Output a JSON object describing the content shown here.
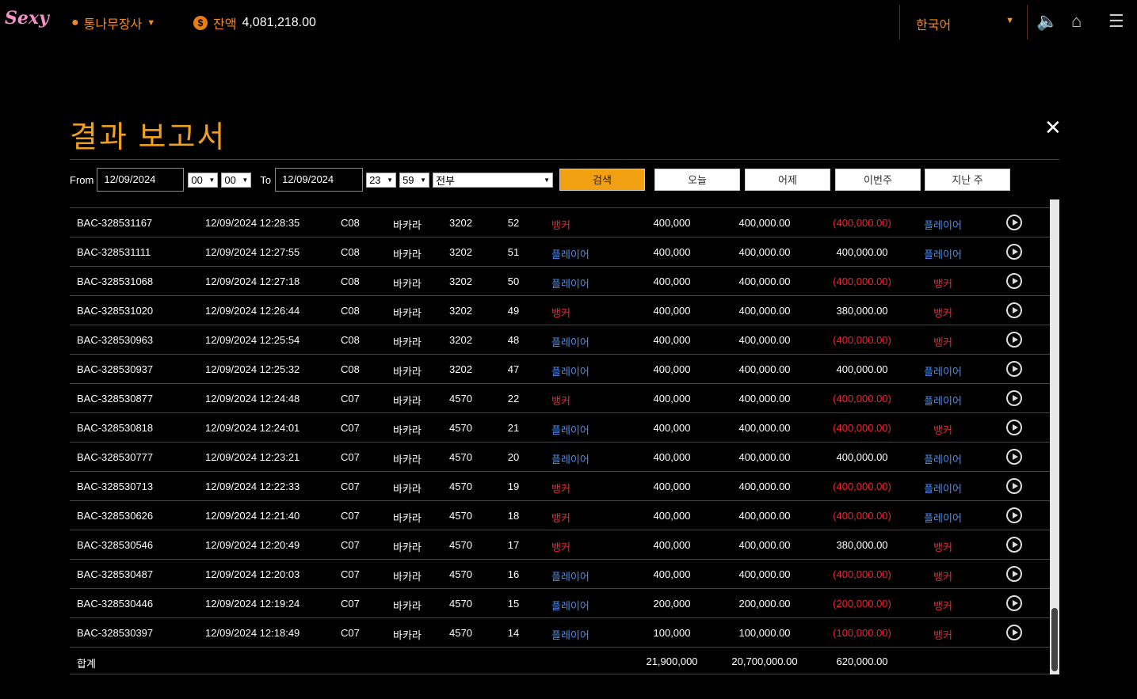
{
  "header": {
    "logo": "Sexy",
    "username": "통나무장사",
    "balance_label": "잔액",
    "balance": "4,081,218.00",
    "language": "한국어"
  },
  "title": "결과 보고서",
  "filters": {
    "from_label": "From",
    "from_date": "12/09/2024",
    "from_hour": "00",
    "from_min": "00",
    "to_label": "To",
    "to_date": "12/09/2024",
    "to_hour": "23",
    "to_min": "59",
    "game_type": "전부"
  },
  "buttons": {
    "search": "검색",
    "today": "오늘",
    "yesterday": "어제",
    "this_week": "이번주",
    "last_week": "지난 주"
  },
  "rows": [
    [
      "BAC-328531167",
      "12/09/2024 12:28:35",
      "C08",
      "바카라",
      "3202",
      "52",
      "뱅커",
      "400,000",
      "400,000.00",
      "(400,000.00)",
      "플레이어"
    ],
    [
      "BAC-328531111",
      "12/09/2024 12:27:55",
      "C08",
      "바카라",
      "3202",
      "51",
      "플레이어",
      "400,000",
      "400,000.00",
      "400,000.00",
      "플레이어"
    ],
    [
      "BAC-328531068",
      "12/09/2024 12:27:18",
      "C08",
      "바카라",
      "3202",
      "50",
      "플레이어",
      "400,000",
      "400,000.00",
      "(400,000.00)",
      "뱅커"
    ],
    [
      "BAC-328531020",
      "12/09/2024 12:26:44",
      "C08",
      "바카라",
      "3202",
      "49",
      "뱅커",
      "400,000",
      "400,000.00",
      "380,000.00",
      "뱅커"
    ],
    [
      "BAC-328530963",
      "12/09/2024 12:25:54",
      "C08",
      "바카라",
      "3202",
      "48",
      "플레이어",
      "400,000",
      "400,000.00",
      "(400,000.00)",
      "뱅커"
    ],
    [
      "BAC-328530937",
      "12/09/2024 12:25:32",
      "C08",
      "바카라",
      "3202",
      "47",
      "플레이어",
      "400,000",
      "400,000.00",
      "400,000.00",
      "플레이어"
    ],
    [
      "BAC-328530877",
      "12/09/2024 12:24:48",
      "C07",
      "바카라",
      "4570",
      "22",
      "뱅커",
      "400,000",
      "400,000.00",
      "(400,000.00)",
      "플레이어"
    ],
    [
      "BAC-328530818",
      "12/09/2024 12:24:01",
      "C07",
      "바카라",
      "4570",
      "21",
      "플레이어",
      "400,000",
      "400,000.00",
      "(400,000.00)",
      "뱅커"
    ],
    [
      "BAC-328530777",
      "12/09/2024 12:23:21",
      "C07",
      "바카라",
      "4570",
      "20",
      "플레이어",
      "400,000",
      "400,000.00",
      "400,000.00",
      "플레이어"
    ],
    [
      "BAC-328530713",
      "12/09/2024 12:22:33",
      "C07",
      "바카라",
      "4570",
      "19",
      "뱅커",
      "400,000",
      "400,000.00",
      "(400,000.00)",
      "플레이어"
    ],
    [
      "BAC-328530626",
      "12/09/2024 12:21:40",
      "C07",
      "바카라",
      "4570",
      "18",
      "뱅커",
      "400,000",
      "400,000.00",
      "(400,000.00)",
      "플레이어"
    ],
    [
      "BAC-328530546",
      "12/09/2024 12:20:49",
      "C07",
      "바카라",
      "4570",
      "17",
      "뱅커",
      "400,000",
      "400,000.00",
      "380,000.00",
      "뱅커"
    ],
    [
      "BAC-328530487",
      "12/09/2024 12:20:03",
      "C07",
      "바카라",
      "4570",
      "16",
      "플레이어",
      "400,000",
      "400,000.00",
      "(400,000.00)",
      "뱅커"
    ],
    [
      "BAC-328530446",
      "12/09/2024 12:19:24",
      "C07",
      "바카라",
      "4570",
      "15",
      "플레이어",
      "200,000",
      "200,000.00",
      "(200,000.00)",
      "뱅커"
    ],
    [
      "BAC-328530397",
      "12/09/2024 12:18:49",
      "C07",
      "바카라",
      "4570",
      "14",
      "플레이어",
      "100,000",
      "100,000.00",
      "(100,000.00)",
      "뱅커"
    ]
  ],
  "totals": {
    "label": "합계",
    "bet": "21,900,000",
    "valid": "20,700,000.00",
    "winloss": "620,000.00"
  },
  "colors": {
    "accent": "#f0a020",
    "banker": "#f2242c",
    "player": "#4a8cf0"
  }
}
